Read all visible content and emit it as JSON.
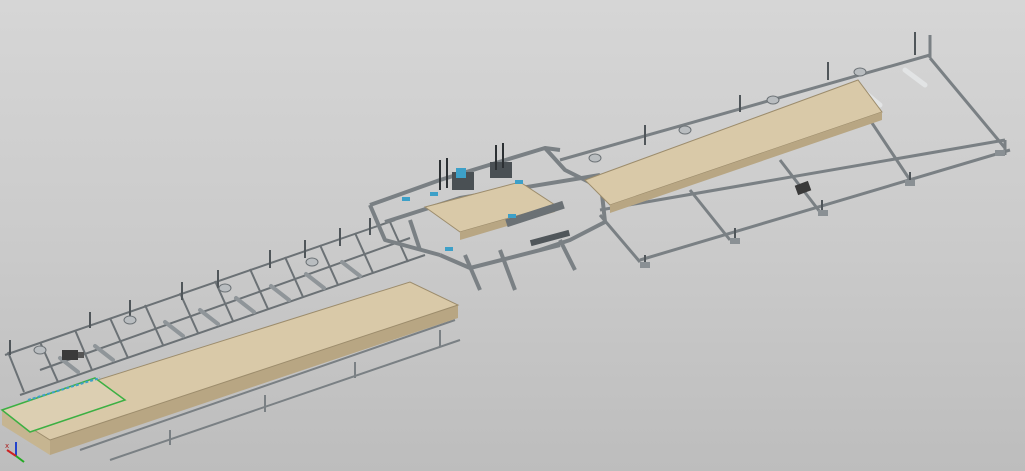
{
  "viewport": {
    "view_type": "isometric-3d-cad-model",
    "background_top": "#d6d6d6",
    "background_bottom": "#bdbdbd"
  },
  "model": {
    "description_visible": false,
    "panel_color": "#d9c9a8",
    "panel_edge_color": "#b8a683",
    "frame_color": "#9aa0a4",
    "frame_dark_color": "#5e6468",
    "accent_color": "#3da0c8",
    "motor_color": "#3a3a3a"
  },
  "triad": {
    "x_label": "x",
    "x_color": "#cc2222",
    "y_color": "#22aa22",
    "z_color": "#2244cc"
  }
}
